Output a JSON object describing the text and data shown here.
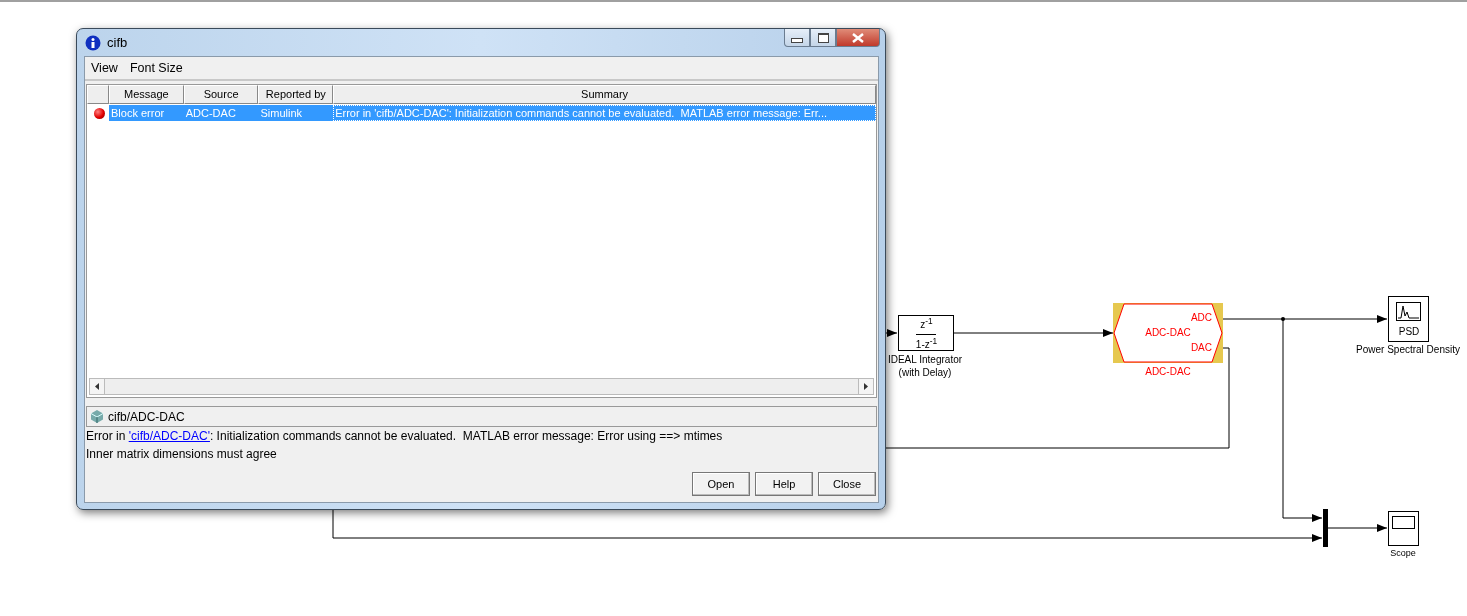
{
  "window": {
    "title": "cifb"
  },
  "menu": [
    "View",
    "Font Size"
  ],
  "table": {
    "columns": [
      "Message",
      "Source",
      "Reported by",
      "Summary"
    ],
    "rows": [
      {
        "kind": "error",
        "selected": true,
        "cells": [
          "Block error",
          "ADC-DAC",
          "Simulink",
          "Error in 'cifb/ADC-DAC': Initialization commands cannot be evaluated.  MATLAB error message: Err..."
        ]
      }
    ]
  },
  "details": {
    "path": "cifb/ADC-DAC",
    "before_link": "Error in ",
    "link": "'cifb/ADC-DAC'",
    "after_link": ": Initialization commands cannot be evaluated.  MATLAB error message: Error using ==> mtimes",
    "line_2": "Inner matrix dimensions must agree"
  },
  "buttons": [
    "Open",
    "Help",
    "Close"
  ],
  "diagram": {
    "integrator": {
      "numerator": "z$^{-1}$",
      "denominator": "1-z$^{-1}$",
      "label_1": "IDEAL Integrator",
      "label_2": "(with Delay)"
    },
    "subsystem": {
      "port_1": "ADC",
      "center": "ADC-DAC",
      "port_2": "DAC",
      "label": "ADC-DAC",
      "selected": true
    },
    "psd": {
      "text": "PSD",
      "label": "Power Spectral Density"
    },
    "scope": {
      "label": "Scope"
    }
  }
}
